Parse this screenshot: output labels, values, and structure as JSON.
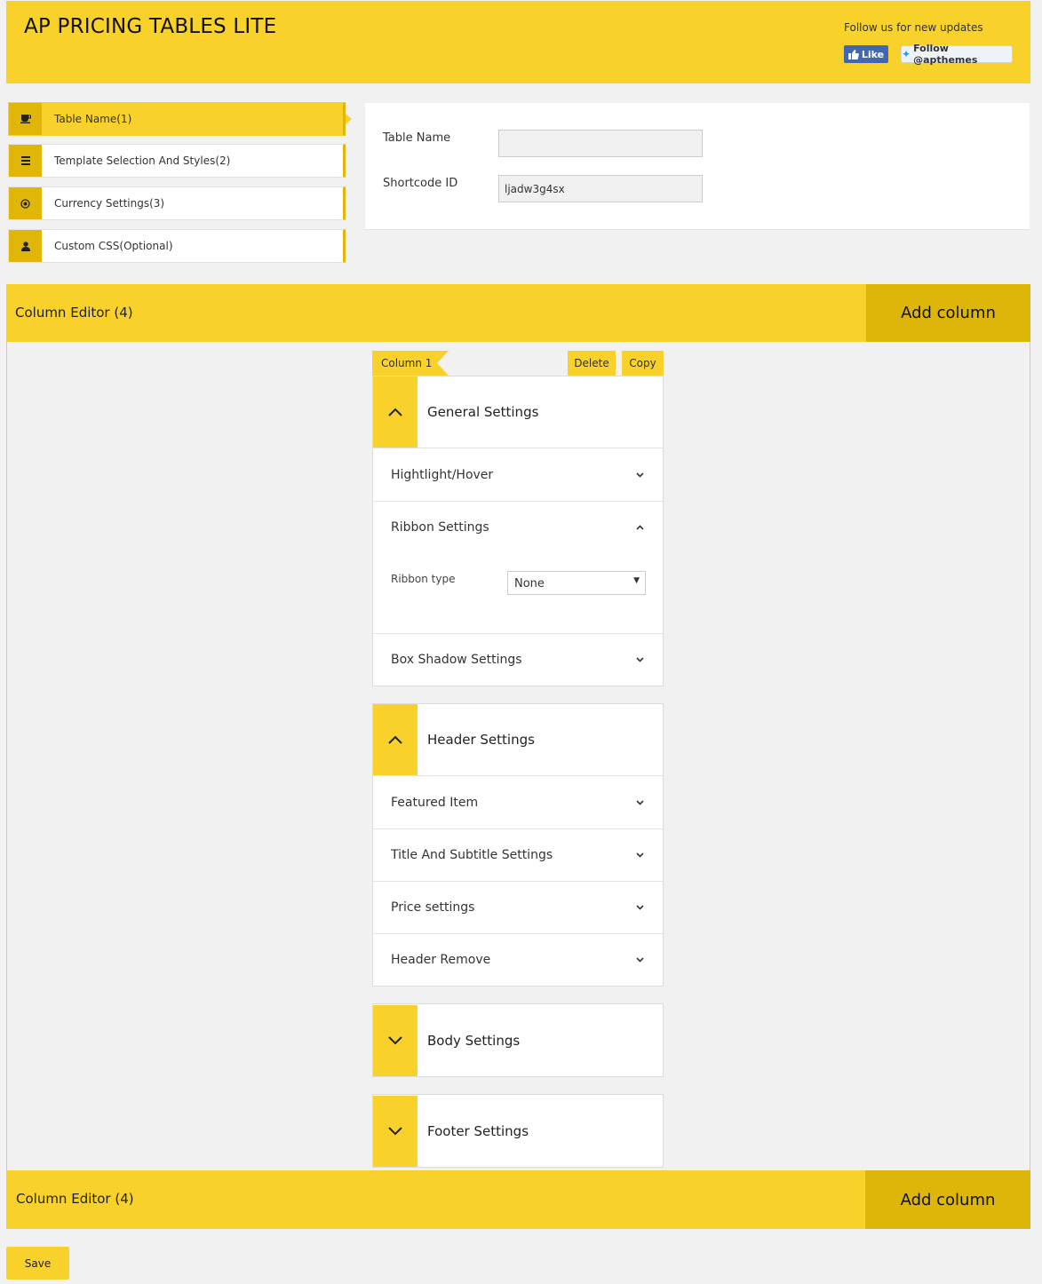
{
  "header": {
    "title": "AP PRICING TABLES LITE",
    "follow_text": "Follow us for new updates",
    "like_label": "Like",
    "twitter_label": "Follow @apthemes"
  },
  "sidebar": {
    "items": [
      {
        "label": "Table Name(1)",
        "icon": "coffee-icon",
        "active": true
      },
      {
        "label": "Template Selection And Styles(2)",
        "icon": "list-icon",
        "active": false
      },
      {
        "label": "Currency Settings(3)",
        "icon": "circle-dot-icon",
        "active": false
      },
      {
        "label": "Custom CSS(Optional)",
        "icon": "user-icon",
        "active": false
      }
    ]
  },
  "table_form": {
    "table_name_label": "Table Name",
    "table_name_value": "",
    "shortcode_label": "Shortcode ID",
    "shortcode_value": "ljadw3g4sx"
  },
  "column_editor": {
    "title": "Column Editor (4)",
    "add_column_label": "Add column"
  },
  "column": {
    "tag": "Column 1",
    "delete_label": "Delete",
    "copy_label": "Copy",
    "general": {
      "title": "General Settings",
      "expanded": true,
      "rows": [
        "Hightlight/Hover",
        "Ribbon Settings",
        "Box Shadow Settings"
      ],
      "ribbon_type_label": "Ribbon type",
      "ribbon_type_value": "None"
    },
    "header": {
      "title": "Header Settings",
      "expanded": true,
      "rows": [
        "Featured Item",
        "Title And Subtitle Settings",
        "Price settings",
        "Header Remove"
      ]
    },
    "body": {
      "title": "Body Settings",
      "expanded": false
    },
    "footer": {
      "title": "Footer Settings",
      "expanded": false
    }
  },
  "save_label": "Save",
  "colors": {
    "accent": "#f8d12a",
    "accent_dark": "#deb509",
    "background": "#f1f1f1"
  }
}
